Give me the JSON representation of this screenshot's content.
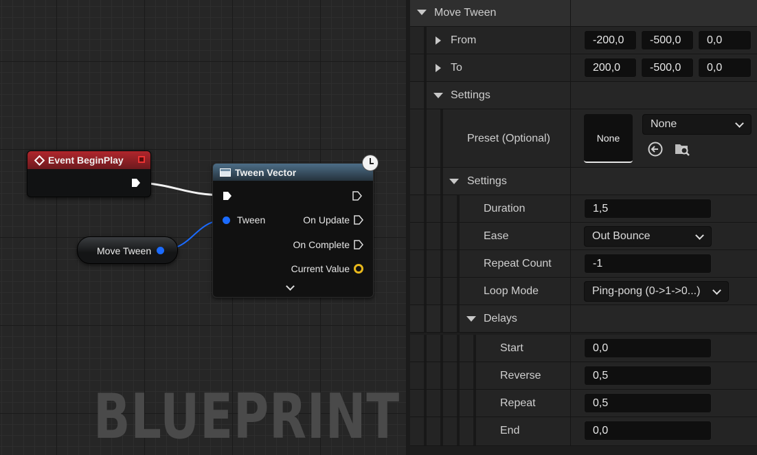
{
  "graph": {
    "watermark": "BLUEPRINT",
    "event_node": {
      "title": "Event BeginPlay"
    },
    "tween_node": {
      "title": "Tween Vector",
      "inputs": {
        "tween": "Tween"
      },
      "outputs": {
        "on_update": "On Update",
        "on_complete": "On Complete",
        "current_value": "Current Value"
      }
    },
    "variable_node": {
      "label": "Move Tween"
    },
    "colors": {
      "event_header": "#b0262c",
      "func_header": "#4d6e87",
      "object_pin": "#1b6bff",
      "vector_pin": "#e8b81c"
    }
  },
  "details": {
    "header": "Move Tween",
    "from": {
      "label": "From",
      "x": "-200,0",
      "y": "-500,0",
      "z": "0,0"
    },
    "to": {
      "label": "To",
      "x": "200,0",
      "y": "-500,0",
      "z": "0,0"
    },
    "settings": {
      "label": "Settings"
    },
    "preset": {
      "label": "Preset (Optional)",
      "thumb": "None",
      "value": "None"
    },
    "inner_settings": {
      "label": "Settings"
    },
    "duration": {
      "label": "Duration",
      "value": "1,5"
    },
    "ease": {
      "label": "Ease",
      "value": "Out Bounce"
    },
    "repeat_count": {
      "label": "Repeat Count",
      "value": "-1"
    },
    "loop_mode": {
      "label": "Loop Mode",
      "value": "Ping-pong (0->1->0...)"
    },
    "delays": {
      "label": "Delays",
      "start": {
        "label": "Start",
        "value": "0,0"
      },
      "reverse": {
        "label": "Reverse",
        "value": "0,5"
      },
      "repeat": {
        "label": "Repeat",
        "value": "0,5"
      },
      "end": {
        "label": "End",
        "value": "0,0"
      }
    }
  }
}
